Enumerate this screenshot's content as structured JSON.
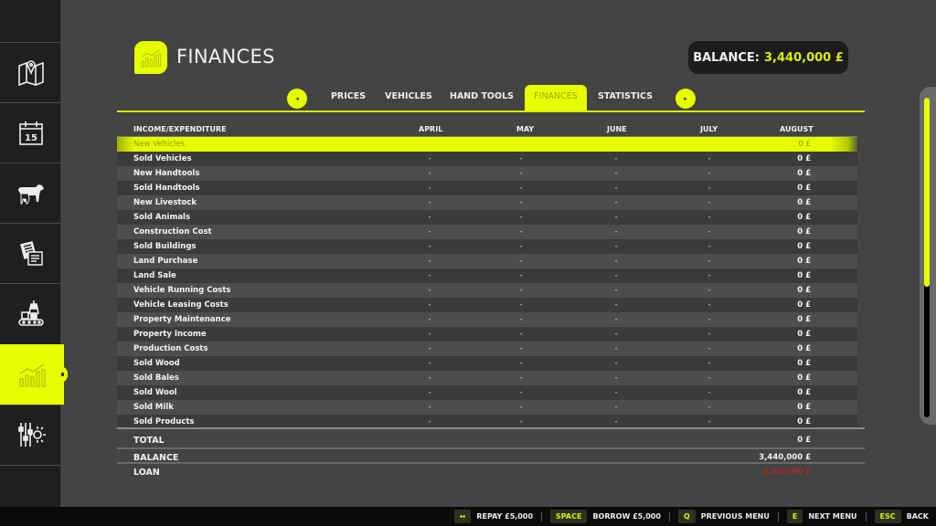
{
  "sidebar": {
    "items": [
      {
        "id": "map",
        "icon": "map-icon",
        "active": false
      },
      {
        "id": "calendar",
        "icon": "calendar-icon",
        "label": "15",
        "active": false
      },
      {
        "id": "animals",
        "icon": "animals-icon",
        "active": false
      },
      {
        "id": "contracts",
        "icon": "contracts-icon",
        "active": false
      },
      {
        "id": "production",
        "icon": "production-icon",
        "active": false
      },
      {
        "id": "finances",
        "icon": "finances-chart-icon",
        "active": true
      },
      {
        "id": "settings",
        "icon": "settings-icon",
        "active": false
      }
    ]
  },
  "header": {
    "title": "FINANCES",
    "balance_label": "BALANCE:",
    "balance_value": "3,440,000 £"
  },
  "tabs": {
    "prev_icon": "◂",
    "next_icon": "▸",
    "items": [
      {
        "label": "PRICES",
        "active": false
      },
      {
        "label": "VEHICLES",
        "active": false
      },
      {
        "label": "HAND TOOLS",
        "active": false
      },
      {
        "label": "FINANCES",
        "active": true
      },
      {
        "label": "STATISTICS",
        "active": false
      }
    ]
  },
  "table": {
    "columns": [
      "INCOME/EXPENDITURE",
      "APRIL",
      "MAY",
      "JUNE",
      "JULY",
      "AUGUST"
    ],
    "rows": [
      {
        "name": "New Vehicles",
        "values": [
          "-",
          "-",
          "-",
          "-",
          "0 £"
        ],
        "highlighted": true
      },
      {
        "name": "Sold Vehicles",
        "values": [
          "-",
          "-",
          "-",
          "-",
          "0 £"
        ]
      },
      {
        "name": "New Handtools",
        "values": [
          "-",
          "-",
          "-",
          "-",
          "0 £"
        ]
      },
      {
        "name": "Sold Handtools",
        "values": [
          "-",
          "-",
          "-",
          "-",
          "0 £"
        ]
      },
      {
        "name": "New Livestock",
        "values": [
          "-",
          "-",
          "-",
          "-",
          "0 £"
        ]
      },
      {
        "name": "Sold Animals",
        "values": [
          "-",
          "-",
          "-",
          "-",
          "0 £"
        ]
      },
      {
        "name": "Construction Cost",
        "values": [
          "-",
          "-",
          "-",
          "-",
          "0 £"
        ]
      },
      {
        "name": "Sold Buildings",
        "values": [
          "-",
          "-",
          "-",
          "-",
          "0 £"
        ]
      },
      {
        "name": "Land Purchase",
        "values": [
          "-",
          "-",
          "-",
          "-",
          "0 £"
        ]
      },
      {
        "name": "Land Sale",
        "values": [
          "-",
          "-",
          "-",
          "-",
          "0 £"
        ]
      },
      {
        "name": "Vehicle Running Costs",
        "values": [
          "-",
          "-",
          "-",
          "-",
          "0 £"
        ]
      },
      {
        "name": "Vehicle Leasing Costs",
        "values": [
          "-",
          "-",
          "-",
          "-",
          "0 £"
        ]
      },
      {
        "name": "Property Maintenance",
        "values": [
          "-",
          "-",
          "-",
          "-",
          "0 £"
        ]
      },
      {
        "name": "Property Income",
        "values": [
          "-",
          "-",
          "-",
          "-",
          "0 £"
        ]
      },
      {
        "name": "Production Costs",
        "values": [
          "-",
          "-",
          "-",
          "-",
          "0 £"
        ]
      },
      {
        "name": "Sold Wood",
        "values": [
          "-",
          "-",
          "-",
          "-",
          "0 £"
        ]
      },
      {
        "name": "Sold Bales",
        "values": [
          "-",
          "-",
          "-",
          "-",
          "0 £"
        ]
      },
      {
        "name": "Sold Wool",
        "values": [
          "-",
          "-",
          "-",
          "-",
          "0 £"
        ]
      },
      {
        "name": "Sold Milk",
        "values": [
          "-",
          "-",
          "-",
          "-",
          "0 £"
        ]
      },
      {
        "name": "Sold Products",
        "values": [
          "-",
          "-",
          "-",
          "-",
          "0 £"
        ]
      }
    ]
  },
  "summary": {
    "total_label": "TOTAL",
    "total_value": "0 £",
    "balance_label": "BALANCE",
    "balance_value": "3,440,000 £",
    "loan_label": "LOAN",
    "loan_value": "-3,440,000 £"
  },
  "scroll": {
    "position_fraction": 0.0,
    "visible_fraction": 0.59
  },
  "footer": {
    "actions": [
      {
        "key": "↔",
        "label": "REPAY £5,000"
      },
      {
        "key": "SPACE",
        "label": "BORROW £5,000"
      },
      {
        "key": "Q",
        "label": "PREVIOUS MENU"
      },
      {
        "key": "E",
        "label": "NEXT MENU"
      },
      {
        "key": "ESC",
        "label": "BACK"
      }
    ]
  },
  "colors": {
    "accent": "#e6ff00",
    "accent_text": "#d7f000",
    "negative": "#e01818",
    "background": "#444444",
    "sidebar": "#1f1f1f"
  }
}
